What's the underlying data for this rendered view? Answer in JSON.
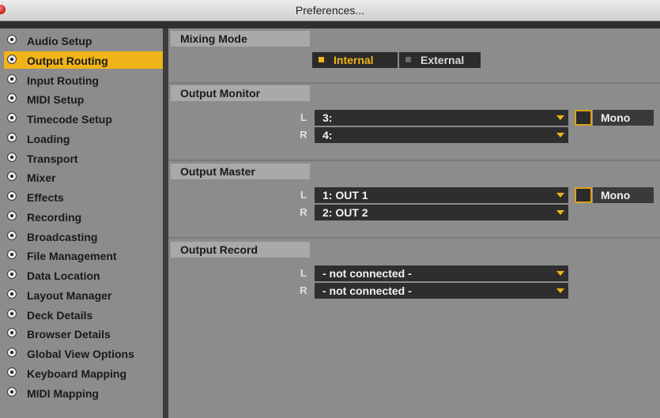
{
  "window": {
    "title": "Preferences..."
  },
  "sidebar": {
    "items": [
      {
        "label": "Audio Setup"
      },
      {
        "label": "Output Routing"
      },
      {
        "label": "Input Routing"
      },
      {
        "label": "MIDI Setup"
      },
      {
        "label": "Timecode Setup"
      },
      {
        "label": "Loading"
      },
      {
        "label": "Transport"
      },
      {
        "label": "Mixer"
      },
      {
        "label": "Effects"
      },
      {
        "label": "Recording"
      },
      {
        "label": "Broadcasting"
      },
      {
        "label": "File Management"
      },
      {
        "label": "Data Location"
      },
      {
        "label": "Layout Manager"
      },
      {
        "label": "Deck Details"
      },
      {
        "label": "Browser Details"
      },
      {
        "label": "Global View Options"
      },
      {
        "label": "Keyboard Mapping"
      },
      {
        "label": "MIDI Mapping"
      }
    ],
    "selected": "Output Routing"
  },
  "mixing_mode": {
    "header": "Mixing Mode",
    "internal_label": "Internal",
    "external_label": "External",
    "selected": "Internal"
  },
  "output_monitor": {
    "header": "Output Monitor",
    "left_channel": "L",
    "left_value": "3:",
    "right_channel": "R",
    "right_value": "4:",
    "mono_label": "Mono"
  },
  "output_master": {
    "header": "Output Master",
    "left_channel": "L",
    "left_value": "1: OUT 1",
    "right_channel": "R",
    "right_value": "2: OUT 2",
    "mono_label": "Mono"
  },
  "output_record": {
    "header": "Output Record",
    "left_channel": "L",
    "left_value": "- not connected -",
    "right_channel": "R",
    "right_value": "- not connected -"
  },
  "colors": {
    "accent": "#f0b418",
    "panel": "#8c8c8c",
    "control": "#2e2e2e"
  }
}
